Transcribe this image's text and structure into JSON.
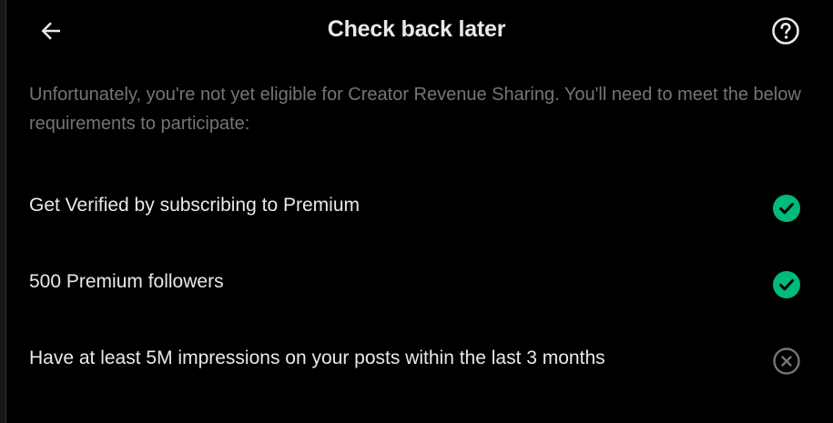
{
  "header": {
    "title": "Check back later",
    "back_icon": "arrow-left-icon",
    "help_icon": "question-circle-icon"
  },
  "description": "Unfortunately, you're not yet eligible for Creator Revenue Sharing. You'll need to meet the below requirements to participate:",
  "requirements": [
    {
      "label": "Get Verified by subscribing to Premium",
      "met": true,
      "icon": "check-circle-icon"
    },
    {
      "label": "500 Premium followers",
      "met": true,
      "icon": "check-circle-icon"
    },
    {
      "label": "Have at least 5M impressions on your posts within the last 3 months",
      "met": false,
      "icon": "x-circle-icon"
    }
  ],
  "colors": {
    "background": "#000000",
    "text_primary": "#e7e9ea",
    "text_secondary": "#71767b",
    "success": "#00ba7c",
    "unmet": "#71767b"
  }
}
